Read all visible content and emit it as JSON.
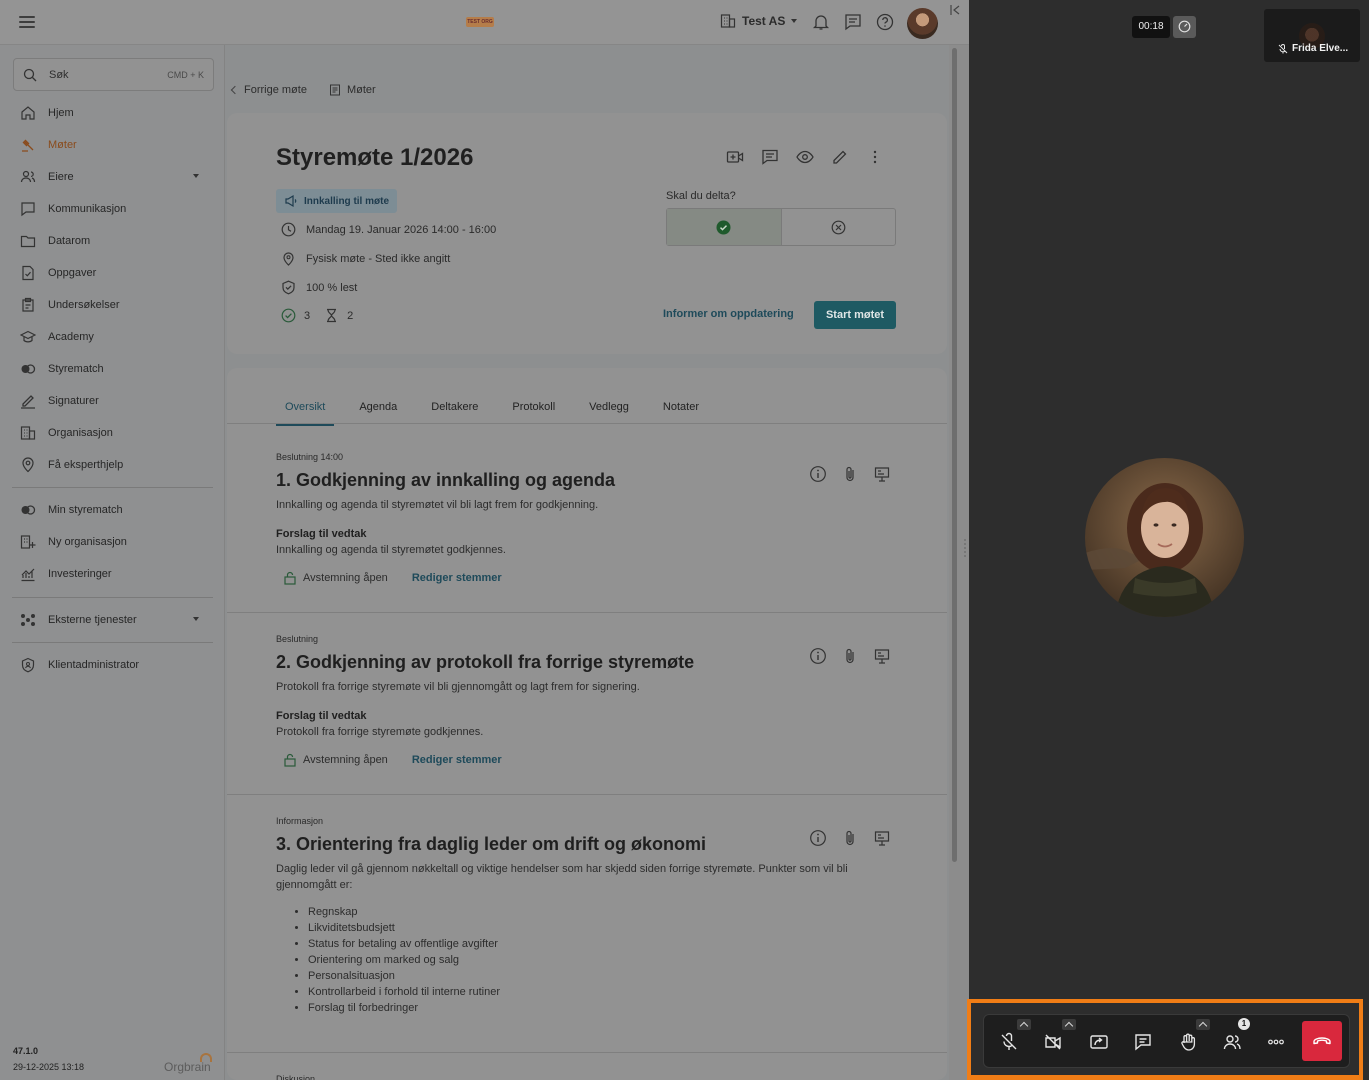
{
  "header": {
    "logo_text": "TEST ORG",
    "company": "Test AS"
  },
  "search": {
    "placeholder": "Søk",
    "shortcut": "CMD + K"
  },
  "sidebar": {
    "items": [
      {
        "label": "Hjem",
        "icon": "home-icon"
      },
      {
        "label": "Møter",
        "icon": "gavel-icon",
        "active": true
      },
      {
        "label": "Eiere",
        "icon": "users-icon",
        "expandable": true
      },
      {
        "label": "Kommunikasjon",
        "icon": "message-icon"
      },
      {
        "label": "Datarom",
        "icon": "folder-icon"
      },
      {
        "label": "Oppgaver",
        "icon": "task-icon"
      },
      {
        "label": "Undersøkelser",
        "icon": "survey-icon"
      },
      {
        "label": "Academy",
        "icon": "graduation-icon"
      },
      {
        "label": "Styrematch",
        "icon": "match-icon"
      },
      {
        "label": "Signaturer",
        "icon": "pen-icon"
      },
      {
        "label": "Organisasjon",
        "icon": "building-icon"
      },
      {
        "label": "Få eksperthjelp",
        "icon": "expert-icon"
      }
    ],
    "secondary": [
      {
        "label": "Min styrematch",
        "icon": "match-icon"
      },
      {
        "label": "Ny organisasjon",
        "icon": "building-add-icon"
      },
      {
        "label": "Investeringer",
        "icon": "chart-icon"
      }
    ],
    "external": {
      "label": "Eksterne tjenester",
      "icon": "apps-icon"
    },
    "admin": {
      "label": "Klientadministrator",
      "icon": "shield-icon"
    },
    "version": "47.1.0",
    "build_date": "29-12-2025 13:18",
    "brand": "Orgbrain"
  },
  "breadcrumb": {
    "back": "Forrige møte",
    "meetings": "Møter"
  },
  "meeting": {
    "title": "Styremøte 1/2026",
    "notice_badge": "Innkalling til møte",
    "datetime": "Mandag 19. Januar 2026 14:00 - 16:00",
    "location": "Fysisk møte - Sted ikke angitt",
    "read": "100 % lest",
    "accepted_count": "3",
    "pending_count": "2",
    "rsvp_question": "Skal du delta?",
    "inform_link": "Informer om oppdatering",
    "start_button": "Start møtet"
  },
  "tabs": [
    "Oversikt",
    "Agenda",
    "Deltakere",
    "Protokoll",
    "Vedlegg",
    "Notater"
  ],
  "agenda": {
    "items": [
      {
        "type": "Beslutning 14:00",
        "title": "1. Godkjenning av innkalling og agenda",
        "description": "Innkalling og agenda til styremøtet vil bli lagt frem for godkjenning.",
        "proposal_title": "Forslag til vedtak",
        "proposal": "Innkalling og agenda til styremøtet godkjennes.",
        "vote_status": "Avstemning åpen",
        "vote_edit": "Rediger stemmer"
      },
      {
        "type": "Beslutning",
        "title": "2. Godkjenning av protokoll fra forrige styremøte",
        "description": "Protokoll fra forrige styremøte vil bli gjennomgått og lagt frem for signering.",
        "proposal_title": "Forslag til vedtak",
        "proposal": "Protokoll fra forrige styremøte godkjennes.",
        "vote_status": "Avstemning åpen",
        "vote_edit": "Rediger stemmer"
      },
      {
        "type": "Informasjon",
        "title": "3. Orientering fra daglig leder om drift og økonomi",
        "description": "Daglig leder vil gå gjennom nøkkeltall og viktige hendelser som har skjedd siden forrige styremøte. Punkter som vil bli gjennomgått er:",
        "bullets": [
          "Regnskap",
          "Likviditetsbudsjett",
          "Status for betaling av offentlige avgifter",
          "Orientering om marked og salg",
          "Personalsituasjon",
          "Kontrollarbeid i forhold til interne rutiner",
          "Forslag til forbedringer"
        ]
      },
      {
        "type": "Diskusjon"
      }
    ]
  },
  "call": {
    "timer": "00:18",
    "participant_name": "Frida Elve...",
    "participants_count": "1",
    "hangup_color": "#d9283d",
    "highlight_color": "#f07d16"
  }
}
